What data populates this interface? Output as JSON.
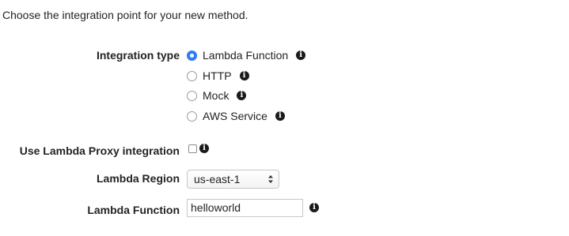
{
  "intro": "Choose the integration point for your new method.",
  "integration_type": {
    "label": "Integration type",
    "options": [
      {
        "label": "Lambda Function",
        "selected": true
      },
      {
        "label": "HTTP",
        "selected": false
      },
      {
        "label": "Mock",
        "selected": false
      },
      {
        "label": "AWS Service",
        "selected": false
      }
    ]
  },
  "proxy": {
    "label": "Use Lambda Proxy integration",
    "checked": false
  },
  "region": {
    "label": "Lambda Region",
    "value": "us-east-1"
  },
  "function": {
    "label": "Lambda Function",
    "value": "helloworld"
  },
  "icons": {
    "info": "info-icon",
    "select_arrows": "chevron-updown-icon"
  },
  "colors": {
    "radio_selected": "#2d7ff9",
    "text": "#232323"
  }
}
